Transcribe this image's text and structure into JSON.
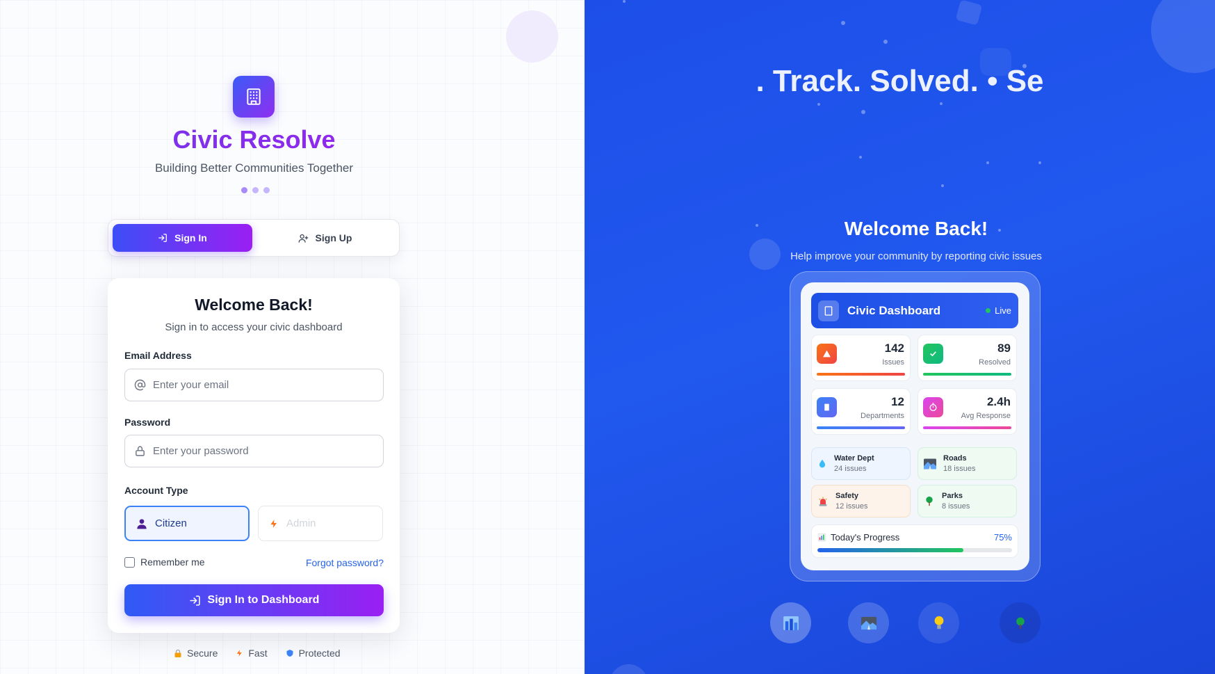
{
  "brand": {
    "title": "Civic Resolve",
    "subtitle": "Building Better Communities Together",
    "logo_icon": "building-icon",
    "accent": "#8a2be2"
  },
  "tabs": [
    {
      "label": "Sign In",
      "icon": "login-icon",
      "active": true
    },
    {
      "label": "Sign Up",
      "icon": "user-plus-icon",
      "active": false
    }
  ],
  "form": {
    "title": "Welcome Back!",
    "subtitle": "Sign in to access your civic dashboard",
    "email": {
      "label": "Email Address",
      "placeholder": "Enter your email",
      "value": ""
    },
    "password": {
      "label": "Password",
      "placeholder": "Enter your password",
      "value": ""
    },
    "account_type": {
      "label": "Account Type",
      "options": [
        {
          "label": "Citizen",
          "icon": "user-icon",
          "selected": true
        },
        {
          "label": "Admin",
          "icon": "lightning-icon",
          "selected": false
        }
      ]
    },
    "remember_label": "Remember me",
    "remember_checked": false,
    "forgot_label": "Forgot password?",
    "submit_label": "Sign In to Dashboard"
  },
  "badges": [
    {
      "label": "Secure",
      "icon": "lock-icon"
    },
    {
      "label": "Fast",
      "icon": "lightning-icon"
    },
    {
      "label": "Protected",
      "icon": "shield-icon"
    }
  ],
  "hero": {
    "headline": ". Track. Solved. • Se",
    "welcome": "Welcome Back!",
    "subtitle": "Help improve your community by reporting civic issues"
  },
  "dashboard": {
    "title": "Civic Dashboard",
    "status": "Live",
    "stats": [
      {
        "value": "142",
        "label": "Issues",
        "icon": "alert-icon",
        "color": "#f97316"
      },
      {
        "value": "89",
        "label": "Resolved",
        "icon": "check-icon",
        "color": "#22c55e"
      },
      {
        "value": "12",
        "label": "Departments",
        "icon": "building-icon",
        "color": "#3b82f6"
      },
      {
        "value": "2.4h",
        "label": "Avg Response",
        "icon": "stopwatch-icon",
        "color": "#d946ef"
      }
    ],
    "departments": [
      {
        "name": "Water Dept",
        "count": "24 issues",
        "icon": "droplet-icon",
        "bg": "#eef5fe"
      },
      {
        "name": "Roads",
        "count": "18 issues",
        "icon": "road-icon",
        "bg": "#eefaf2"
      },
      {
        "name": "Safety",
        "count": "12 issues",
        "icon": "siren-icon",
        "bg": "#fdf3ea"
      },
      {
        "name": "Parks",
        "count": "8 issues",
        "icon": "tree-icon",
        "bg": "#eefaf2"
      }
    ],
    "progress": {
      "label": "Today's Progress",
      "value_text": "75%",
      "value": 0.75,
      "icon": "bar-chart-icon"
    }
  },
  "bottom_icons": [
    "city-icon",
    "road-icon",
    "lightbulb-icon",
    "tree-icon"
  ]
}
